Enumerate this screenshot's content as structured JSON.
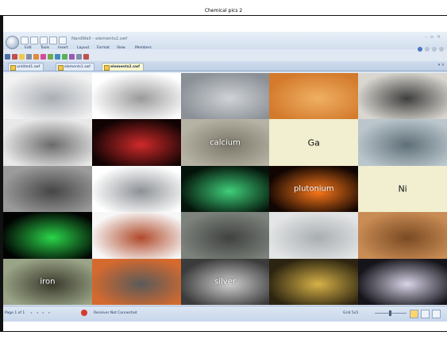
{
  "page_title": "Chemical pics 2",
  "window": {
    "title": "NardWall - elements2.swf",
    "menu": [
      "Edit",
      "Tools",
      "Insert",
      "Layout",
      "Format",
      "View",
      "Members"
    ],
    "tabs": [
      {
        "label": "untitled1.swf",
        "active": false
      },
      {
        "label": "elements1.swf",
        "active": false
      },
      {
        "label": "elements2.swf",
        "active": true
      }
    ]
  },
  "tiles": [
    {
      "label": "",
      "icon": "aluminium-cans-image",
      "colors": [
        "#f2f2f2",
        "#a9aeb4"
      ]
    },
    {
      "label": "",
      "icon": "metal-discs-image",
      "colors": [
        "#ffffff",
        "#9a9a9a"
      ]
    },
    {
      "label": "",
      "icon": "metal-chunks-image",
      "colors": [
        "#8b9097",
        "#cfd3d6"
      ]
    },
    {
      "label": "",
      "icon": "crystals-on-dish-image",
      "colors": [
        "#d37a2c",
        "#f0b063"
      ]
    },
    {
      "label": "",
      "icon": "dark-ingot-image",
      "colors": [
        "#d8d6cf",
        "#3f3f3f"
      ]
    },
    {
      "label": "",
      "icon": "metal-shards-image",
      "colors": [
        "#e8e8e8",
        "#6b6b6b"
      ]
    },
    {
      "label": "",
      "icon": "red-flame-image",
      "colors": [
        "#120303",
        "#cf2a2a"
      ]
    },
    {
      "label": "calcium",
      "icon": "calcium-crystals-image",
      "colors": [
        "#b6b2a4",
        "#7a7668"
      ]
    },
    {
      "label": "Ga",
      "icon": "",
      "colors": [
        "#f1efcf",
        "#e7e3b8"
      ]
    },
    {
      "label": "",
      "icon": "metal-pellets-image",
      "colors": [
        "#bac6cc",
        "#5f6f78"
      ]
    },
    {
      "label": "",
      "icon": "metal-ring-image",
      "colors": [
        "#9b9b9b",
        "#454545"
      ]
    },
    {
      "label": "",
      "icon": "metal-bars-image",
      "colors": [
        "#ffffff",
        "#8d9196"
      ]
    },
    {
      "label": "",
      "icon": "green-flame-image",
      "colors": [
        "#04140a",
        "#3fcf7a"
      ]
    },
    {
      "label": "plutonium",
      "icon": "plutonium-pellet-image",
      "colors": [
        "#120602",
        "#ff7a1a"
      ]
    },
    {
      "label": "Ni",
      "icon": "",
      "colors": [
        "#f1efcf",
        "#e7e3b8"
      ]
    },
    {
      "label": "",
      "icon": "green-glow-tube-image",
      "colors": [
        "#010402",
        "#2bd64a"
      ]
    },
    {
      "label": "",
      "icon": "toaster-image",
      "colors": [
        "#f7f7f7",
        "#b04a2a"
      ]
    },
    {
      "label": "",
      "icon": "metal-pipes-image",
      "colors": [
        "#7e827c",
        "#3f4240"
      ]
    },
    {
      "label": "",
      "icon": "mercury-flask-image",
      "colors": [
        "#e3e5e6",
        "#a9aeb1"
      ]
    },
    {
      "label": "",
      "icon": "coin-image",
      "colors": [
        "#c98c55",
        "#7a4a22"
      ]
    },
    {
      "label": "iron",
      "icon": "cannon-image",
      "colors": [
        "#9aa487",
        "#3a3a2c"
      ]
    },
    {
      "label": "",
      "icon": "gloved-hands-disc-image",
      "colors": [
        "#d56a2e",
        "#5a5a5a"
      ]
    },
    {
      "label": "silver",
      "icon": "silverware-image",
      "colors": [
        "#3b3b3b",
        "#cfcfcf"
      ]
    },
    {
      "label": "",
      "icon": "gold-nugget-image",
      "colors": [
        "#2c2410",
        "#d7b248"
      ]
    },
    {
      "label": "",
      "icon": "sparks-image",
      "colors": [
        "#15141a",
        "#d9d4e8"
      ]
    }
  ],
  "status": {
    "page": "Page 1 of 1",
    "message": "Receiver Not Connected",
    "zoom": "Grid 5x5"
  }
}
